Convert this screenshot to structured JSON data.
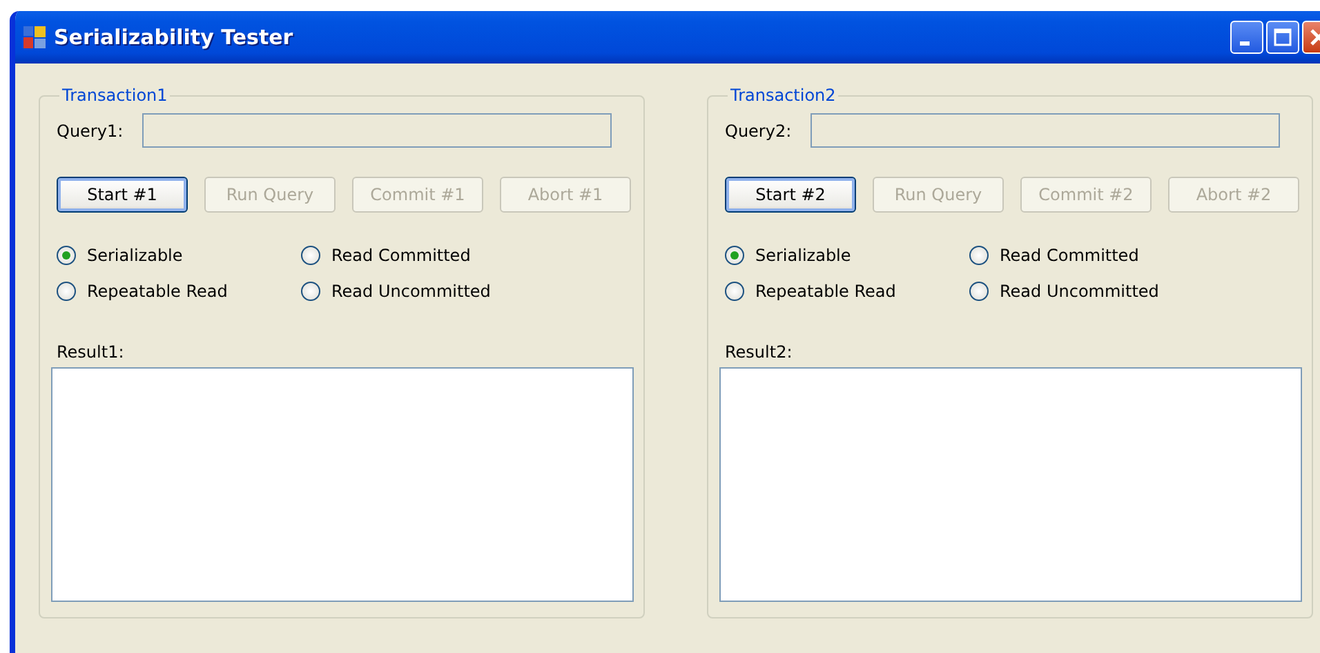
{
  "window": {
    "title": "Serializability Tester",
    "controls": [
      {
        "kind": "minimize"
      },
      {
        "kind": "maximize"
      },
      {
        "kind": "close"
      }
    ]
  },
  "transactions": [
    {
      "title": "Transaction1",
      "query_label": "Query1:",
      "buttons": [
        {
          "label": "Start #1",
          "disabled": false,
          "default": true
        },
        {
          "label": "Run Query",
          "disabled": true,
          "default": false
        },
        {
          "label": "Commit #1",
          "disabled": true,
          "default": false
        },
        {
          "label": "Abort #1",
          "disabled": true,
          "default": false
        }
      ],
      "isolation": [
        {
          "label": "Serializable",
          "selected": true
        },
        {
          "label": "Read Committed",
          "selected": false
        },
        {
          "label": "Repeatable Read",
          "selected": false
        },
        {
          "label": "Read Uncommitted",
          "selected": false
        }
      ],
      "result_label": "Result1:"
    },
    {
      "title": "Transaction2",
      "query_label": "Query2:",
      "buttons": [
        {
          "label": "Start #2",
          "disabled": false,
          "default": true
        },
        {
          "label": "Run Query",
          "disabled": true,
          "default": false
        },
        {
          "label": "Commit #2",
          "disabled": true,
          "default": false
        },
        {
          "label": "Abort #2",
          "disabled": true,
          "default": false
        }
      ],
      "isolation": [
        {
          "label": "Serializable",
          "selected": true
        },
        {
          "label": "Read Committed",
          "selected": false
        },
        {
          "label": "Repeatable Read",
          "selected": false
        },
        {
          "label": "Read Uncommitted",
          "selected": false
        }
      ],
      "result_label": "Result2:"
    }
  ]
}
